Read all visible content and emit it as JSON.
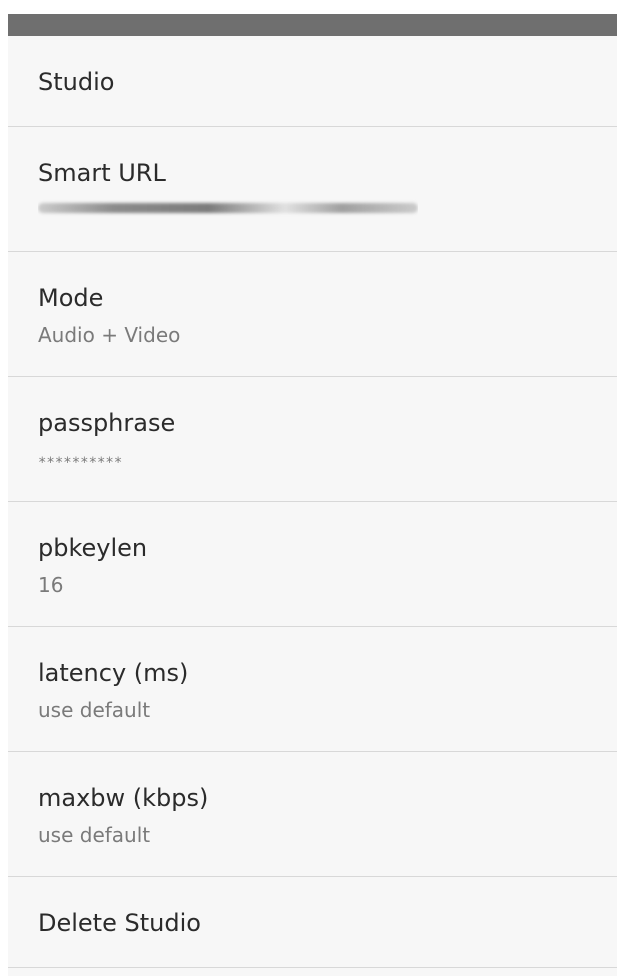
{
  "preferences": [
    {
      "title": "Studio"
    },
    {
      "title": "Smart URL",
      "summary_redacted": true
    },
    {
      "title": "Mode",
      "summary": "Audio + Video"
    },
    {
      "title": "passphrase",
      "summary": "**********"
    },
    {
      "title": "pbkeylen",
      "summary": "16"
    },
    {
      "title": "latency (ms)",
      "summary": "use default"
    },
    {
      "title": "maxbw (kbps)",
      "summary": "use default"
    },
    {
      "title": "Delete Studio"
    }
  ]
}
